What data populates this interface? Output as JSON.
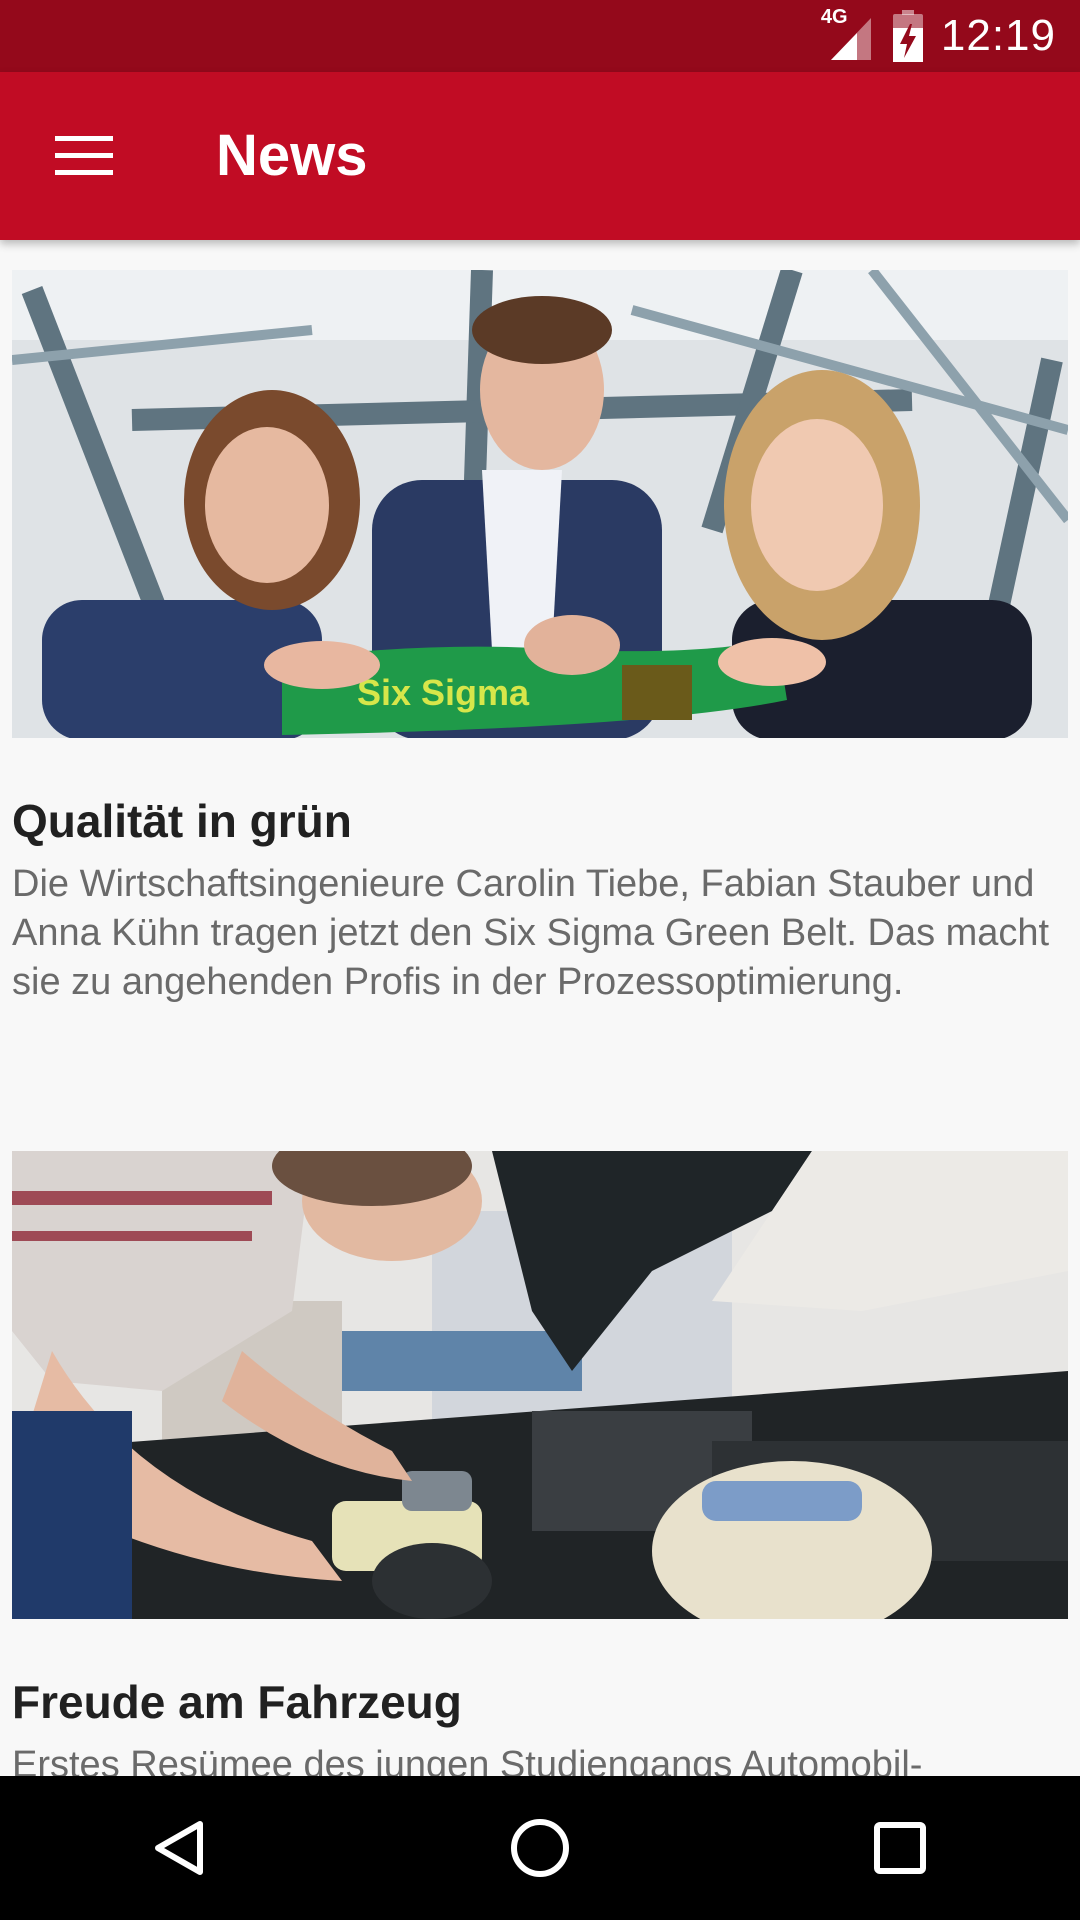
{
  "status_bar": {
    "network": "4G",
    "time": "12:19",
    "icons": [
      "signal-icon",
      "battery-icon"
    ]
  },
  "app_bar": {
    "title": "News",
    "menu_icon": "hamburger-menu-icon",
    "color": "#c10c24"
  },
  "articles": [
    {
      "title": "Qualität in grün",
      "text": "Die Wirtschaftsingenieure Carolin Tiebe, Fabian Stauber und Anna Kühn tragen jetzt den Six Sigma Green Belt. Das macht sie zu angehenden Profis in der Prozessoptimierung.",
      "image_caption": "Six Sigma"
    },
    {
      "title": "Freude am Fahrzeug",
      "text": "Erstes Resümee des jungen Studiengangs Automobil-"
    }
  ],
  "nav_bar": {
    "icons": [
      "back-icon",
      "home-icon",
      "recents-icon"
    ]
  }
}
